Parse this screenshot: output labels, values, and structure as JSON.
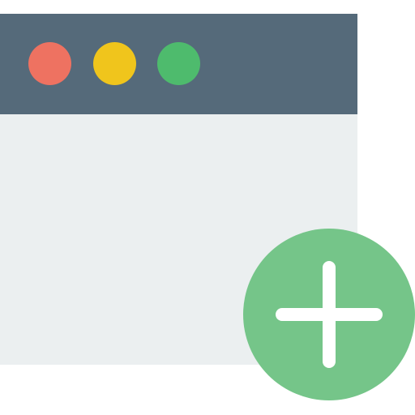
{
  "colors": {
    "titlebar": "#556a7a",
    "content": "#ebeff0",
    "close_dot": "#ee7261",
    "minimize_dot": "#f0c51c",
    "maximize_dot": "#4ebb6d",
    "add_badge": "#75c589",
    "add_plus": "#ffffff"
  },
  "icons": {
    "window": "browser-window-icon",
    "close": "close-dot-icon",
    "minimize": "minimize-dot-icon",
    "maximize": "maximize-dot-icon",
    "add": "plus-icon"
  }
}
